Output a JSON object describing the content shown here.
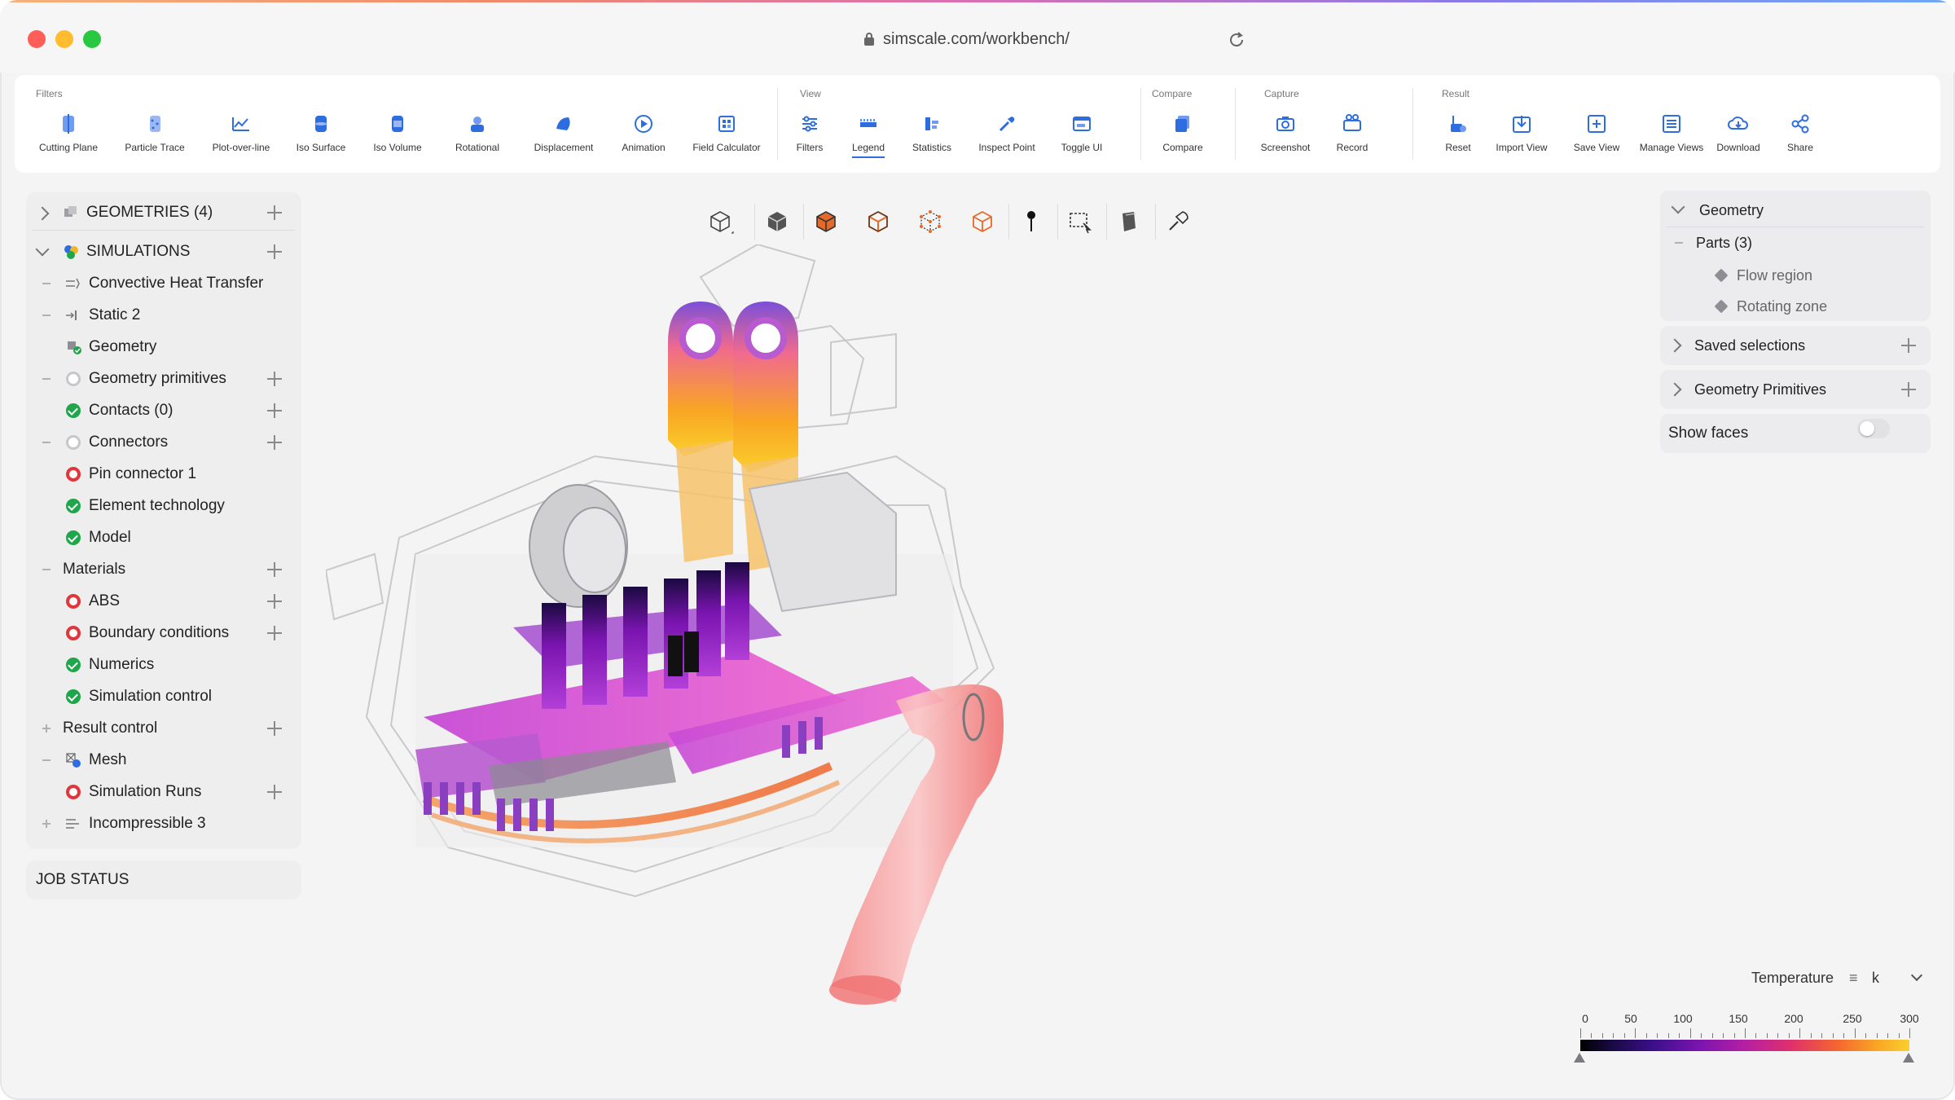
{
  "window": {
    "url": "simscale.com/workbench/"
  },
  "toolbar": {
    "groups": [
      {
        "label": "Filters",
        "buttons": [
          "Cutting Plane",
          "Particle Trace",
          "Plot-over-line",
          "Iso Surface",
          "Iso Volume",
          "Rotational",
          "Displacement",
          "Animation",
          "Field Calculator"
        ]
      },
      {
        "label": "View",
        "buttons": [
          "Filters",
          "Legend",
          "Statistics",
          "Inspect Point",
          "Toggle UI"
        ]
      },
      {
        "label": "Compare",
        "buttons": [
          "Compare"
        ]
      },
      {
        "label": "Capture",
        "buttons": [
          "Screenshot",
          "Record"
        ]
      },
      {
        "label": "Result",
        "buttons": [
          "Reset",
          "Import View",
          "Save View",
          "Manage Views",
          "Download",
          "Share"
        ]
      }
    ],
    "active_button": "Legend",
    "accent_color": "#2d6de0"
  },
  "tree": {
    "geometries_label": "GEOMETRIES (4)",
    "simulations_label": "SIMULATIONS",
    "items": [
      {
        "label": "Convective Heat Transfer",
        "icon": "heat-transfer-icon"
      },
      {
        "label": "Static 2",
        "icon": "static-icon"
      },
      {
        "label": "Geometry",
        "icon": "geometry-icon",
        "status": "ok"
      },
      {
        "label": "Geometry primitives",
        "status": "neutral"
      },
      {
        "label": "Contacts (0)",
        "status": "ok"
      },
      {
        "label": "Connectors",
        "status": "neutral"
      },
      {
        "label": "Pin connector 1",
        "status": "error"
      },
      {
        "label": "Element technology",
        "status": "ok"
      },
      {
        "label": "Model",
        "status": "ok"
      },
      {
        "label": "Materials"
      },
      {
        "label": "ABS",
        "status": "error"
      },
      {
        "label": "Boundary conditions",
        "status": "error"
      },
      {
        "label": "Numerics",
        "status": "ok"
      },
      {
        "label": "Simulation control",
        "status": "ok"
      },
      {
        "label": "Result control"
      },
      {
        "label": "Mesh",
        "icon": "mesh-icon"
      },
      {
        "label": "Simulation Runs",
        "status": "error"
      },
      {
        "label": "Incompressible 3",
        "icon": "incompressible-icon"
      }
    ],
    "job_status_label": "JOB STATUS"
  },
  "right_panel": {
    "geometry_label": "Geometry",
    "parts_label": "Parts (3)",
    "parts": [
      "Flow region",
      "Rotating zone"
    ],
    "saved_selections_label": "Saved selections",
    "geometry_primitives_label": "Geometry Primitives",
    "show_faces_label": "Show faces",
    "show_faces_enabled": false
  },
  "legend": {
    "title": "Temperature",
    "unit": "k",
    "ticks": [
      "0",
      "50",
      "100",
      "150",
      "200",
      "250",
      "300"
    ],
    "colors": [
      "#000000",
      "#3b0f8a",
      "#b51fa3",
      "#e0306c",
      "#f4662f",
      "#fad02c"
    ]
  },
  "status_colors": {
    "ok": "#1fa64a",
    "error": "#e0363c",
    "neutral": "#c7c7cb"
  }
}
